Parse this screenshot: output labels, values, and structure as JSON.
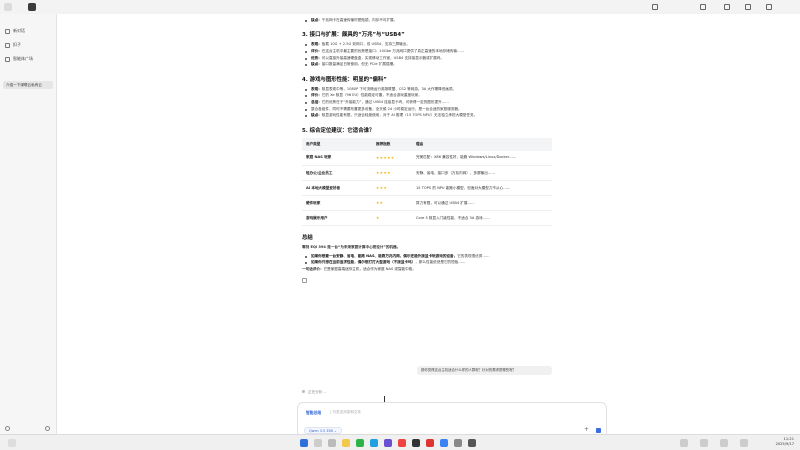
{
  "sidebar": {
    "items": [
      {
        "label": "新对话",
        "icon": "new-chat-icon"
      },
      {
        "label": "扣子",
        "icon": "bot-icon"
      },
      {
        "label": "智能体广场",
        "icon": "agent-square-icon"
      }
    ],
    "active_chat": "介绍一下绿联云私有云"
  },
  "content": {
    "top_bullet": {
      "bold": "缺点：",
      "text": "千兆网卡在高速传输时是瓶颈，内存不可扩展。"
    },
    "section3": {
      "title": "3. 接口与扩展：颇具的“万兆”与“USB4”",
      "bullets": [
        {
          "bold": "表现：",
          "text": "板载 10G + 2.5G 双网口，双 USB4，支持三屏输出。"
        },
        {
          "bold": "评价：",
          "text": "在这台主机中最主要的优势是接口：10Gbe 万兆网口提供了真正高速的本地存储传输……"
        },
        {
          "bold": "优势：",
          "text": "可以直接外接高速硬盘盒，实现移动工作室，USB4 支持接显示器或扩展坞。"
        },
        {
          "bold": "缺点：",
          "text": "接口数量满足日常使用，但无 PCIe 扩展插槽。"
        }
      ]
    },
    "section4": {
      "title": "4. 游戏与图形性能：明显的“偏科”",
      "bullets": [
        {
          "bold": "表现：",
          "text": "核显表现中等，1080P 下可流畅运行英雄联盟、CS2 等网游，3A 大作需降低画质。"
        },
        {
          "bold": "评价：",
          "text": "它的 Xe 核显（96 EU）性能稳定可靠，不适合游戏重度玩家。"
        },
        {
          "bold": "总结：",
          "text": "它的优势在于“外接能力”，通过 USB4 连接显卡坞，可获得一定的图形提升……"
        },
        {
          "bold": "",
          "text": "整合各组件，同时不需要布置更多设备，全天候 24 小时稳定运行，是一台合适的家庭服务器。"
        },
        {
          "bold": "缺点：",
          "text": "核显游戏性能有限，只适合轻度使用，对于 AI 推理（15 TOPS NPU）无法独立承担大模型任务。"
        }
      ]
    },
    "section5": {
      "title": "5. 综合定位建议：它适合谁？",
      "table": {
        "headers": [
          "用户类型",
          "推荐指数",
          "理由"
        ],
        "rows": [
          {
            "user": "家庭 NAS 玩家",
            "stars": "★★★★★",
            "reason": "完美匹配：X86 兼容性好，能跑 Windows/Linux/Docker……"
          },
          {
            "user": "轻办公/企业员工",
            "stars": "★★★★",
            "reason": "安静、省电、接口多（万兆内网），多屏输出……"
          },
          {
            "user": "AI 本地大模型爱好者",
            "stars": "★★★",
            "reason": "15 TOPS 的 NPU 能跑小模型，但面对大模型力不从心……"
          },
          {
            "user": "硬件玩家",
            "stars": "★★",
            "reason": "算力有限，可以通过 USB4 扩展……"
          },
          {
            "user": "游戏娱乐用户",
            "stars": "★",
            "reason": "Core 5 核显入门级性能，不适合 3A 游戏……"
          }
        ]
      }
    },
    "summary": {
      "title": "总结",
      "lead": {
        "bold": "零刻 EQi 394 是一台“为未来家庭计算中心而设计”的机器。",
        "text": ""
      },
      "bullets": [
        {
          "bold": "如果你想要一台安静、省电、能跑 NAS、能跑万兆内网，偶尔还能外接显卡玩游戏的设备，",
          "text": "它的表现很优秀……"
        },
        {
          "bold": "如果你只想在当前追求性能，偶尔想打打大型游戏（不接显卡坞）",
          "text": "，那么性能依然是它的短板……"
        }
      ],
      "closing": {
        "bold": "一句话评价：",
        "text": "它是家庭高端迷你主机，适合作为家庭 NAS 或智能中枢。"
      }
    },
    "user_question": "那你觉得这台主机适合什么样的人群呢？针对的需求是哪些呢？",
    "thinking": "正在分析…"
  },
  "input": {
    "mode": "智能总结",
    "placeholder": "| 可发送消息和文本",
    "model": "Qwen 3.5 35B ⌄"
  },
  "taskbar": {
    "clock_time": "11:21",
    "clock_date": "2025/9/17"
  },
  "colors": {
    "accent": "#3567d6",
    "star": "#f2b400"
  }
}
